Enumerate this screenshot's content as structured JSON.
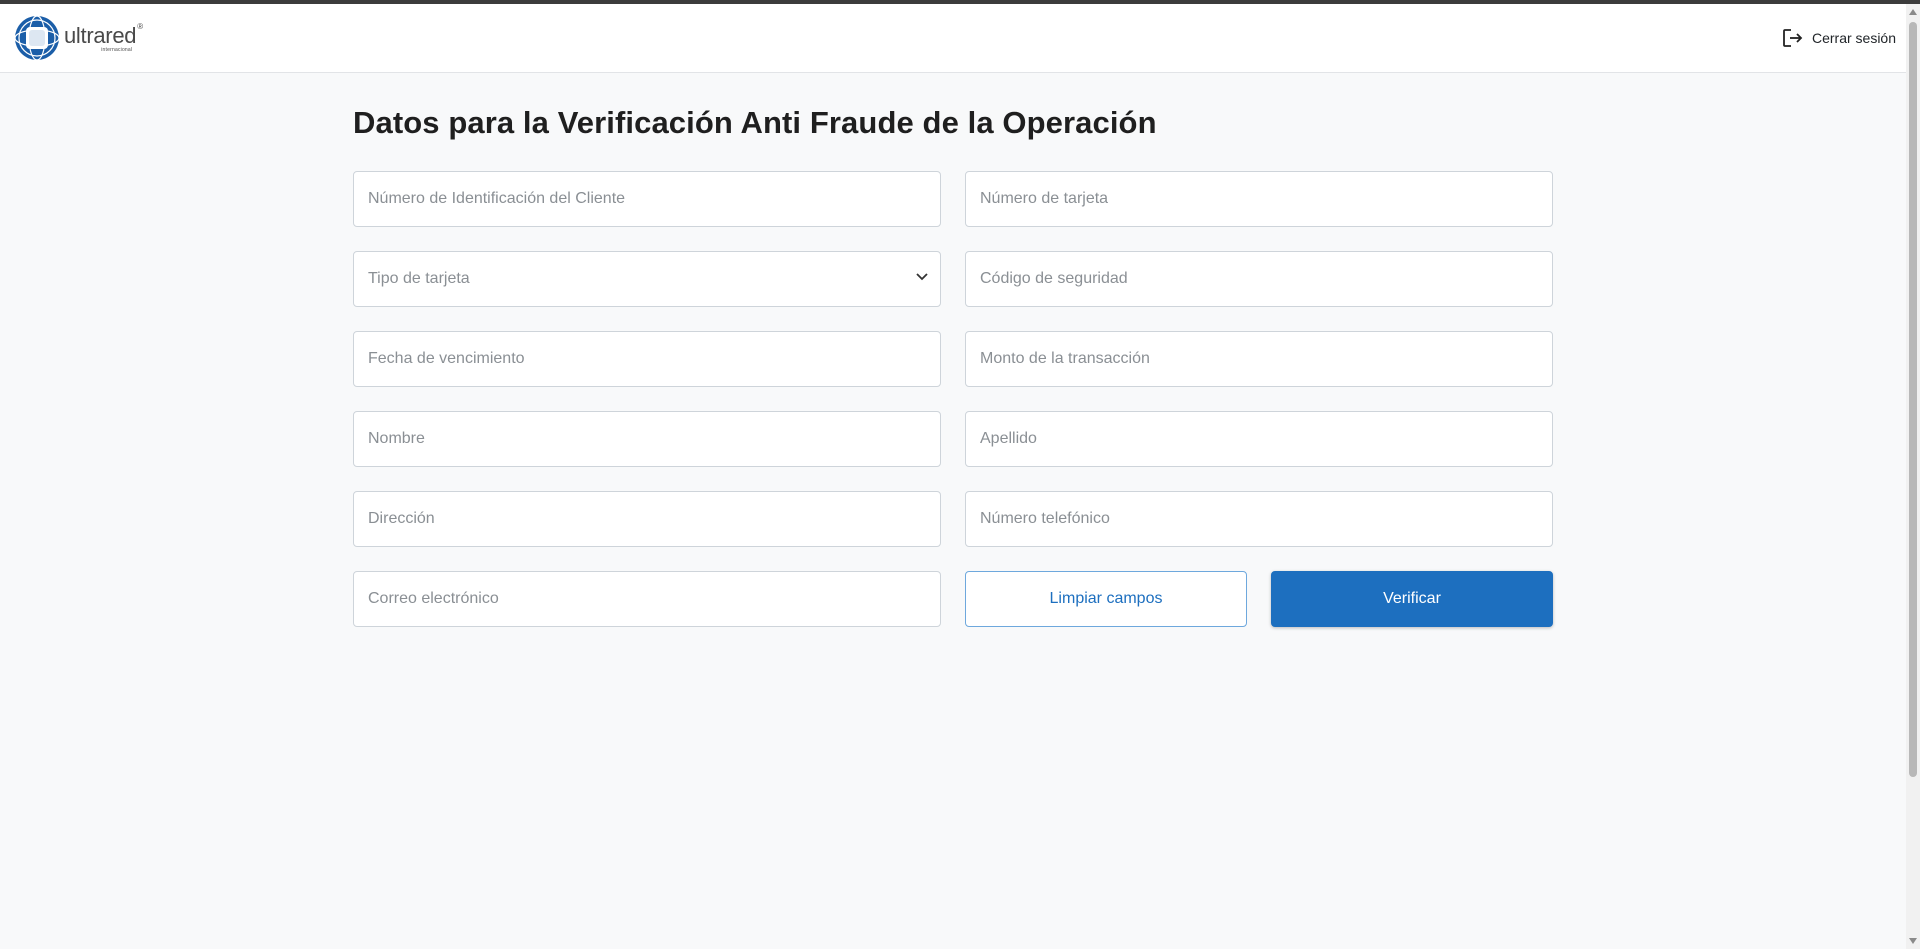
{
  "header": {
    "brand": "ultrared",
    "brand_reg": "®",
    "brand_sub": "internacional",
    "logout_label": "Cerrar sesión"
  },
  "page": {
    "title": "Datos para la Verificación Anti Fraude de la Operación"
  },
  "form": {
    "client_id": {
      "value": "",
      "placeholder": "Número de Identificación del Cliente"
    },
    "card_number": {
      "value": "",
      "placeholder": "Número de tarjeta"
    },
    "card_type": {
      "selected": "Tipo de tarjeta"
    },
    "security_code": {
      "value": "",
      "placeholder": "Código de seguridad"
    },
    "expiry_date": {
      "value": "",
      "placeholder": "Fecha de vencimiento"
    },
    "amount": {
      "value": "",
      "placeholder": "Monto de la transacción"
    },
    "first_name": {
      "value": "",
      "placeholder": "Nombre"
    },
    "last_name": {
      "value": "",
      "placeholder": "Apellido"
    },
    "address": {
      "value": "",
      "placeholder": "Dirección"
    },
    "phone": {
      "value": "",
      "placeholder": "Número telefónico"
    },
    "email": {
      "value": "",
      "placeholder": "Correo electrónico"
    },
    "clear_label": "Limpiar campos",
    "verify_label": "Verificar"
  },
  "colors": {
    "primary": "#1d6fbf",
    "brand_blue": "#1b5ea8",
    "background": "#f8f9fa"
  },
  "icons": {
    "logo": "globe-logo-icon",
    "logout": "logout-icon",
    "dropdown": "chevron-down-icon"
  }
}
